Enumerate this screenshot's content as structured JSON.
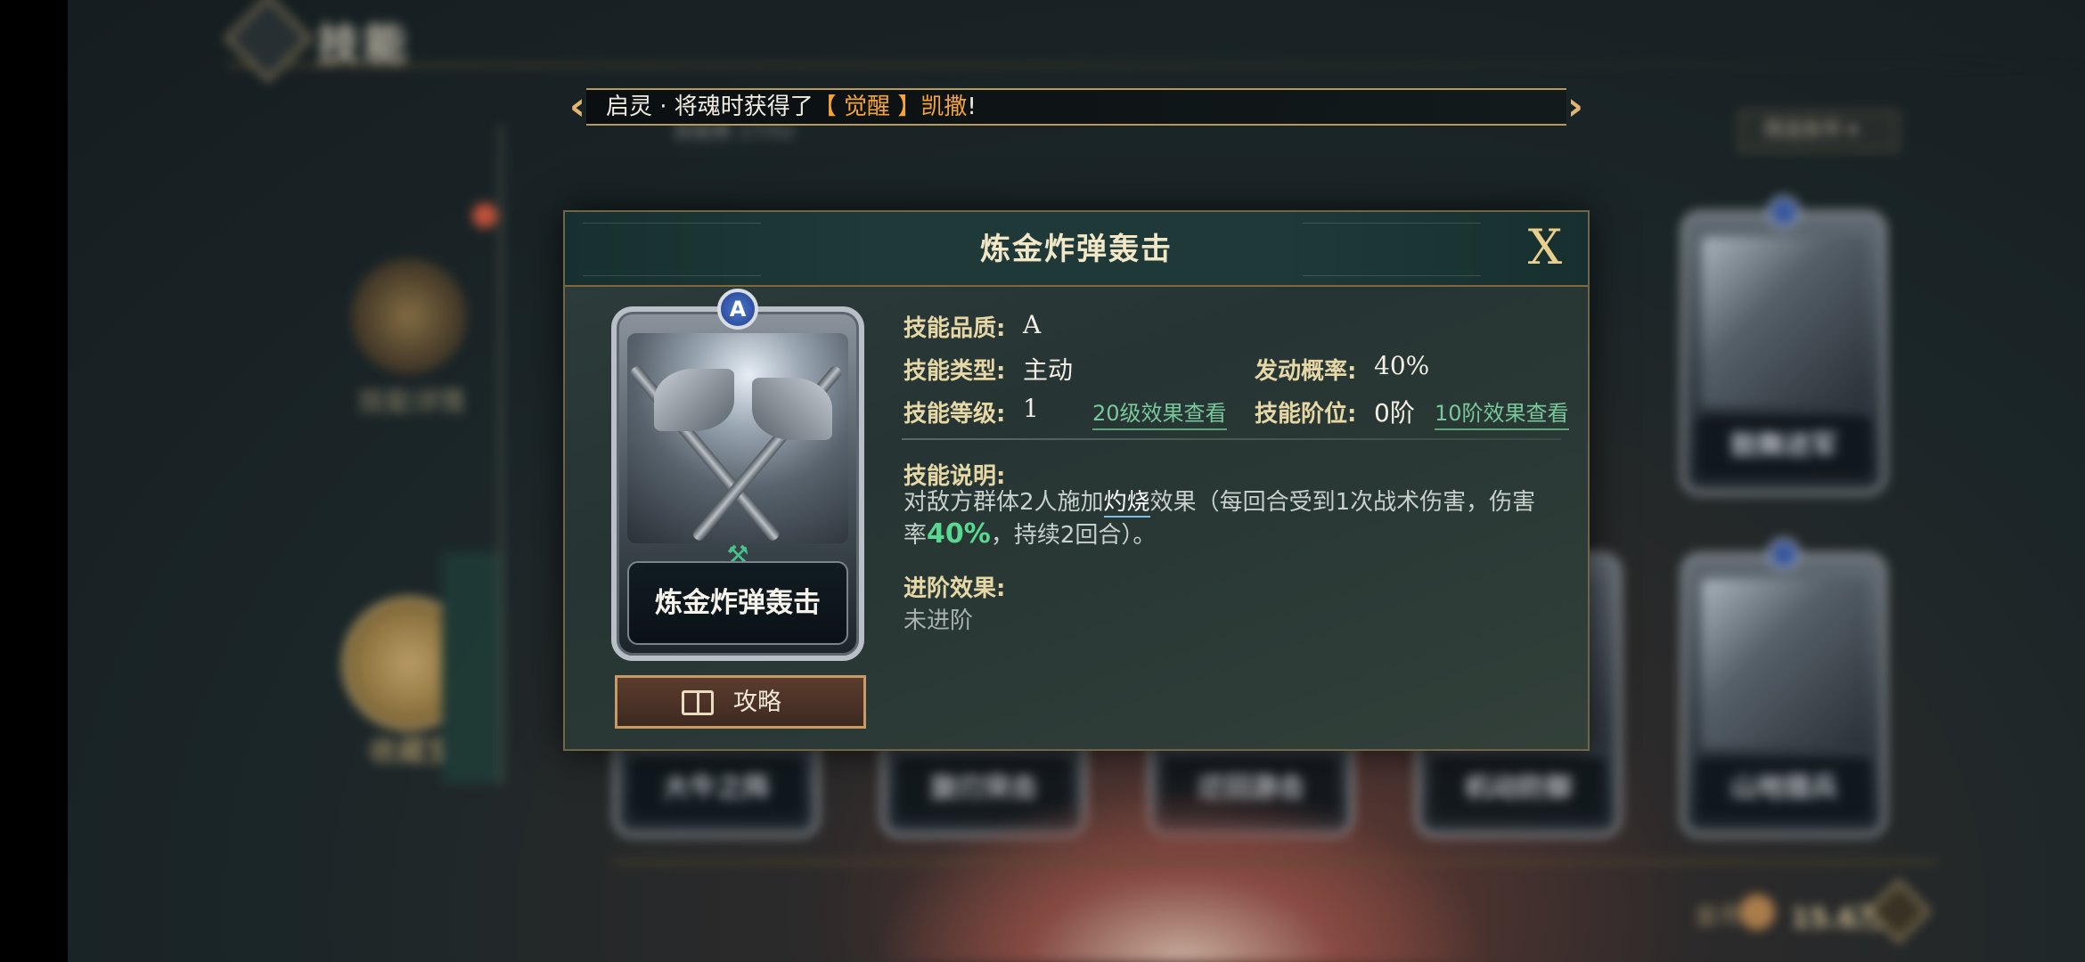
{
  "background": {
    "screen_title": "技能",
    "sub_count": "技能数 17/52",
    "filter_label": "筛选条件",
    "sidebar": [
      {
        "label": "技能详情"
      },
      {
        "label": "收藏室"
      }
    ],
    "cards": [
      {
        "name": "大牛之阵"
      },
      {
        "name": "旋刃突击"
      },
      {
        "name": "迂回游击"
      },
      {
        "name": "机动防御"
      },
      {
        "name": "鼓舞进军"
      },
      {
        "name": "山地猎兵"
      }
    ],
    "currency": {
      "label": "金币",
      "amount": "15.6万",
      "plus": "+"
    }
  },
  "banner": {
    "prefix": "启灵 · 将魂时获得了",
    "highlight": "【 觉醒 】凯撒",
    "suffix": "!",
    "left_arrow": "‹",
    "right_arrow": "›"
  },
  "modal": {
    "title": "炼金炸弹轰击",
    "close_label": "X",
    "card": {
      "rank": "A",
      "name": "炼金炸弹轰击",
      "emblem": "⚒"
    },
    "guide_button": "攻略",
    "info": {
      "quality_label": "技能品质:",
      "quality_value": "A",
      "type_label": "技能类型:",
      "type_value": "主动",
      "trigger_label": "发动概率:",
      "trigger_value": "40%",
      "level_label": "技能等级:",
      "level_value": "1",
      "level_link": "20级效果查看",
      "tier_label": "技能阶位:",
      "tier_value": "0阶",
      "tier_link": "10阶效果查看"
    },
    "description": {
      "label": "技能说明:",
      "part1": "对敌方群体2人施加",
      "keyword": "灼烧",
      "part2": "效果（每回合受到1次战术伤害，伤害率",
      "percent": "40%",
      "part3": "，持续2回合）。"
    },
    "advance": {
      "label": "进阶效果:",
      "value": "未进阶"
    }
  },
  "colors": {
    "accent_gold": "#e0b672",
    "highlight_orange": "#f4a43a",
    "link_green": "#79c89b",
    "percent_green": "#59d98f"
  }
}
